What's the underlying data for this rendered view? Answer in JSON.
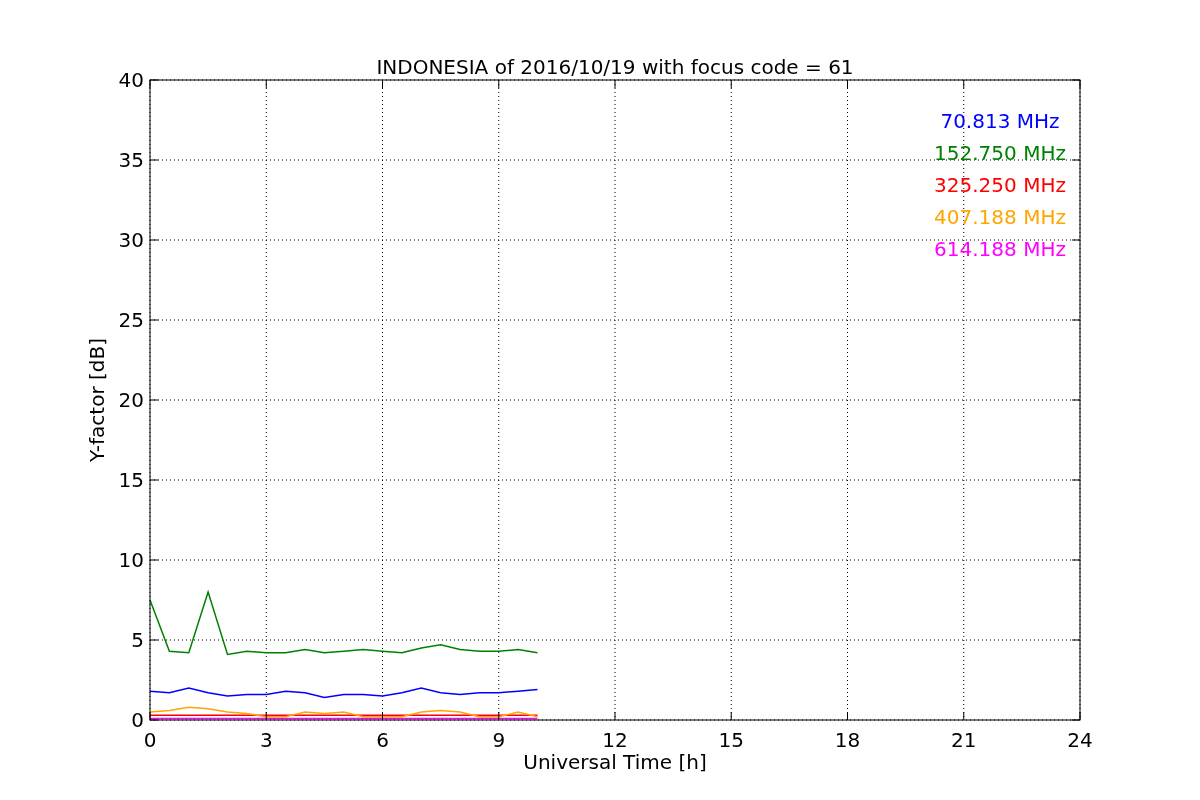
{
  "chart_data": {
    "type": "line",
    "title": "INDONESIA of 2016/10/19 with focus code = 61",
    "xlabel": "Universal Time [h]",
    "ylabel": "Y-factor [dB]",
    "x": [
      0,
      0.5,
      1,
      1.5,
      2,
      2.5,
      3,
      3.5,
      4,
      4.5,
      5,
      5.5,
      6,
      6.5,
      7,
      7.5,
      8,
      8.5,
      9,
      9.5,
      10
    ],
    "series": [
      {
        "name": "70.813 MHz",
        "color": "#0000ff",
        "values": [
          1.8,
          1.7,
          2.0,
          1.7,
          1.5,
          1.6,
          1.6,
          1.8,
          1.7,
          1.4,
          1.6,
          1.6,
          1.5,
          1.7,
          2.0,
          1.7,
          1.6,
          1.7,
          1.7,
          1.8,
          1.9
        ]
      },
      {
        "name": "152.750 MHz",
        "color": "#008000",
        "values": [
          7.5,
          4.3,
          4.2,
          8.0,
          4.1,
          4.3,
          4.2,
          4.2,
          4.4,
          4.2,
          4.3,
          4.4,
          4.3,
          4.2,
          4.5,
          4.7,
          4.4,
          4.3,
          4.3,
          4.4,
          4.2
        ]
      },
      {
        "name": "325.250 MHz",
        "color": "#ff0000",
        "values": [
          0.3,
          0.3,
          0.3,
          0.3,
          0.3,
          0.3,
          0.3,
          0.3,
          0.3,
          0.3,
          0.3,
          0.3,
          0.3,
          0.3,
          0.3,
          0.3,
          0.3,
          0.3,
          0.3,
          0.3,
          0.3
        ]
      },
      {
        "name": "407.188 MHz",
        "color": "#ffa500",
        "values": [
          0.5,
          0.6,
          0.8,
          0.7,
          0.5,
          0.4,
          0.2,
          0.2,
          0.5,
          0.4,
          0.5,
          0.2,
          0.2,
          0.2,
          0.5,
          0.6,
          0.5,
          0.2,
          0.2,
          0.5,
          0.2
        ]
      },
      {
        "name": "614.188 MHz",
        "color": "#ff00ff",
        "values": [
          0.1,
          0.1,
          0.1,
          0.1,
          0.1,
          0.1,
          0.1,
          0.1,
          0.1,
          0.1,
          0.1,
          0.1,
          0.1,
          0.1,
          0.1,
          0.1,
          0.1,
          0.1,
          0.1,
          0.1,
          0.1
        ]
      }
    ],
    "grid": true,
    "xlim": [
      0,
      24
    ],
    "ylim": [
      0,
      40
    ],
    "xticks": [
      0,
      3,
      6,
      9,
      12,
      15,
      18,
      21,
      24
    ],
    "yticks": [
      0,
      5,
      10,
      15,
      20,
      25,
      30,
      35,
      40
    ]
  }
}
